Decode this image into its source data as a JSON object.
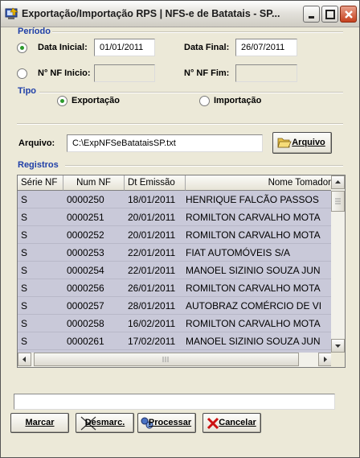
{
  "window": {
    "title": "Exportação/Importação RPS  |  NFS-e de Batatais - SP...",
    "icon": "app-icon",
    "controls": [
      "minimize-icon",
      "maximize-icon",
      "close-icon"
    ]
  },
  "periodo": {
    "title": "Período",
    "data_inicial_label": "Data Inicial:",
    "data_inicial": "01/01/2011",
    "data_final_label": "Data Final:",
    "data_final": "26/07/2011",
    "nf_inicio_label": "N° NF Inicio:",
    "nf_inicio": "",
    "nf_fim_label": "N° NF Fim:",
    "nf_fim": "",
    "selected": "data"
  },
  "tipo": {
    "title": "Tipo",
    "exportacao_label": "Exportação",
    "importacao_label": "Importação",
    "selected": "exportacao"
  },
  "arquivo": {
    "label": "Arquivo:",
    "value": "C:\\ExpNFSeBatataisSP.txt",
    "button_label": "Arquivo"
  },
  "registros": {
    "title": "Registros",
    "columns": [
      "Série NF",
      "Num NF",
      "Dt Emissão",
      "Nome Tomador"
    ],
    "rows": [
      [
        "S",
        "0000250",
        "18/01/2011",
        "HENRIQUE FALCÃO PASSOS"
      ],
      [
        "S",
        "0000251",
        "20/01/2011",
        "ROMILTON CARVALHO MOTA"
      ],
      [
        "S",
        "0000252",
        "20/01/2011",
        "ROMILTON CARVALHO MOTA"
      ],
      [
        "S",
        "0000253",
        "22/01/2011",
        "FIAT AUTOMÓVEIS S/A"
      ],
      [
        "S",
        "0000254",
        "22/01/2011",
        "MANOEL SIZINIO SOUZA JUN"
      ],
      [
        "S",
        "0000256",
        "26/01/2011",
        "ROMILTON CARVALHO MOTA"
      ],
      [
        "S",
        "0000257",
        "28/01/2011",
        "AUTOBRAZ COMÉRCIO DE VI"
      ],
      [
        "S",
        "0000258",
        "16/02/2011",
        "ROMILTON CARVALHO MOTA"
      ],
      [
        "S",
        "0000261",
        "17/02/2011",
        "MANOEL SIZINIO SOUZA JUN"
      ]
    ]
  },
  "status_text": "",
  "buttons": {
    "marcar": "Marcar",
    "desmarcar": "Desmarc.",
    "processar": "Processar",
    "cancelar": "Cancelar"
  },
  "colors": {
    "group_title": "#1f3fa8",
    "grid_bg": "#c9c9d9",
    "window_bg": "#ece9d8"
  }
}
